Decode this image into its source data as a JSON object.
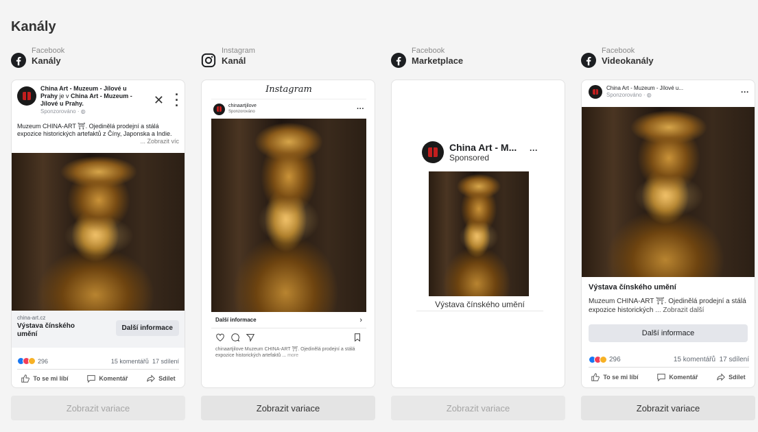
{
  "page": {
    "title": "Kanály"
  },
  "columns": [
    {
      "sub": "Facebook",
      "main": "Kanály",
      "icon": "facebook-icon",
      "button": "Zobrazit variace",
      "button_enabled": false
    },
    {
      "sub": "Instagram",
      "main": "Kanál",
      "icon": "instagram-icon",
      "button": "Zobrazit variace",
      "button_enabled": true
    },
    {
      "sub": "Facebook",
      "main": "Marketplace",
      "icon": "facebook-icon",
      "button": "Zobrazit variace",
      "button_enabled": false
    },
    {
      "sub": "Facebook",
      "main": "Videokanály",
      "icon": "facebook-icon",
      "button": "Zobrazit variace",
      "button_enabled": true
    }
  ],
  "fb_feed": {
    "page_name": "China Art - Muzeum - Jílové u Prahy",
    "connector": " je v ",
    "location": "China Art - Muzeum - Jílové u Prahy.",
    "sponsored": "Sponzorováno · ",
    "text": "Muzeum CHINA-ART ⛩. Ojedinělá prodejní a stálá expozice historických artefaktů z Číny, Japonska a Indie.",
    "more": "... Zobrazit víc",
    "domain": "china-art.cz",
    "headline": "Výstava čínského umění",
    "cta": "Další informace",
    "reaction_count": "296",
    "comments": "15 komentářů",
    "shares": "17 sdílení",
    "like": "To se mi líbí",
    "comment": "Komentář",
    "share": "Sdílet"
  },
  "ig_feed": {
    "logo": "Instagram",
    "handle": "chinaartjilove",
    "sponsored": "Sponzorováno",
    "cta": "Další informace",
    "caption": "chinaartjilove Muzeum CHINA-ART ⛩. Ojedinělá prodejní a stálá expozice historických artefaktů ...",
    "more": "more"
  },
  "marketplace": {
    "name": "China Art - M...",
    "sponsored": "Sponsored",
    "headline": "Výstava čínského umění"
  },
  "fb_video": {
    "page_name": "China Art - Muzeum - Jílové u...",
    "sponsored": "Sponzorováno · ",
    "headline": "Výstava čínského umění",
    "text": "Muzeum CHINA-ART ⛩. Ojedinělá prodejní a stálá expozice historických",
    "more": "... Zobrazit další",
    "cta": "Další informace",
    "reaction_count": "296",
    "comments": "15 komentářů",
    "shares": "17 sdílení",
    "like": "To se mi líbí",
    "comment": "Komentář",
    "share": "Sdílet"
  },
  "colors": {
    "facebook_blue": "#1877f2",
    "like_blue": "#1877f2",
    "love_red": "#f33e58",
    "haha_yellow": "#f7b125"
  }
}
